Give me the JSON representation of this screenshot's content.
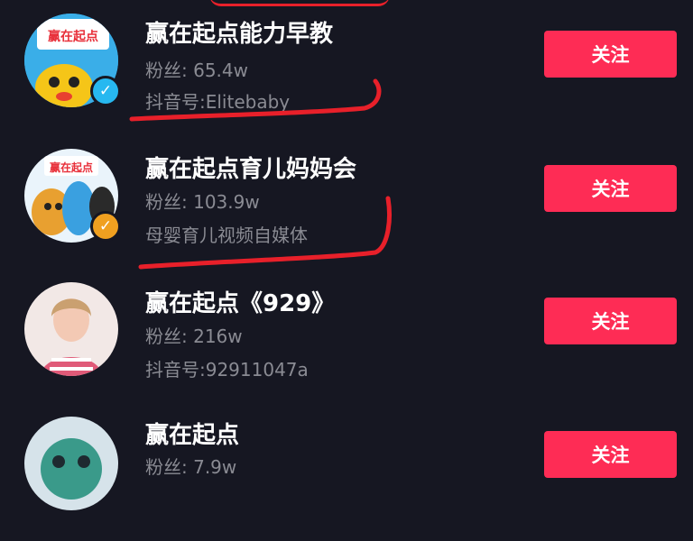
{
  "accounts": [
    {
      "name": "赢在起点能力早教",
      "fans": "粉丝: 65.4w",
      "sub": "抖音号:Elitebaby",
      "follow_label": "关注",
      "badge": "blue-check",
      "logo_text": "赢在起点"
    },
    {
      "name": "赢在起点育儿妈妈会",
      "fans": "粉丝: 103.9w",
      "sub": "母婴育儿视频自媒体",
      "follow_label": "关注",
      "badge": "orange-check",
      "logo_text": "赢在起点"
    },
    {
      "name": "赢在起点《929》",
      "fans": "粉丝: 216w",
      "sub": "抖音号:92911047a",
      "follow_label": "关注"
    },
    {
      "name": "赢在起点",
      "fans": "粉丝: 7.9w",
      "follow_label": "关注"
    }
  ],
  "colors": {
    "background": "#161722",
    "follow_button": "#fe2c55",
    "annotation": "#e8202a",
    "secondary_text": "#8a8b93"
  }
}
